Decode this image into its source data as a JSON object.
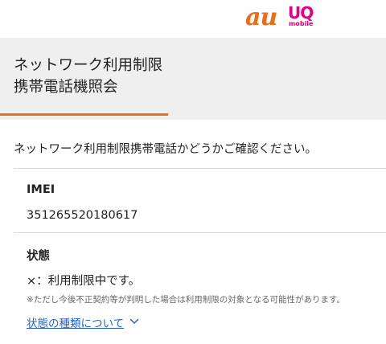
{
  "header": {
    "logo_au": "au",
    "logo_uq_line1": "UQ",
    "logo_uq_line2": "mobile"
  },
  "page": {
    "title_line1": "ネットワーク利用制限",
    "title_line2": "携帯電話機照会"
  },
  "intro": "ネットワーク利用制限携帯電話かどうかご確認ください。",
  "imei": {
    "label": "IMEI",
    "value": "351265520180617"
  },
  "status": {
    "label": "状態",
    "value": "×：利用制限中です。",
    "note": "※ただし今後不正契約等が判明した場合は利用制限の対象となる可能性があります。",
    "link": "状態の種類について"
  },
  "colors": {
    "accent": "#ec6d17",
    "uq_brand": "#e5007f",
    "link": "#2962c4",
    "band": "#efefef"
  },
  "icons": {
    "chevron": "chevron-down-icon"
  }
}
